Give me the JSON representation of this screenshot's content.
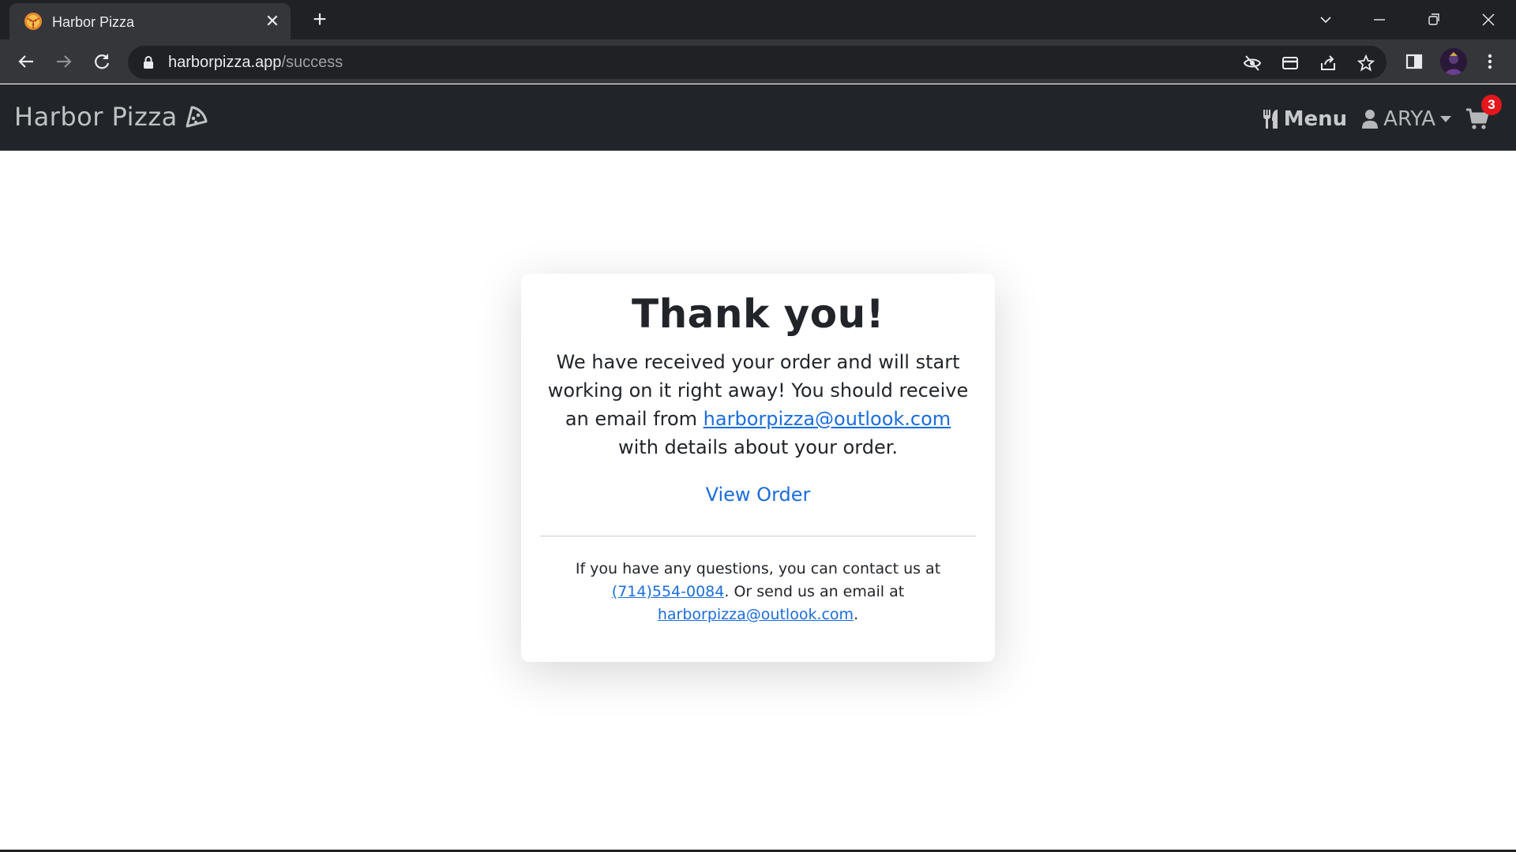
{
  "browser": {
    "tab_title": "Harbor Pizza",
    "url_host": "harborpizza.app",
    "url_path": "/success"
  },
  "navbar": {
    "brand": "Harbor Pizza",
    "menu_label": "Menu",
    "user_label": "ARYA",
    "cart_count": "3"
  },
  "card": {
    "title": "Thank you!",
    "body_prefix": "We have received your order and will start working on it right away! You should receive an email from ",
    "body_email": "harborpizza@outlook.com",
    "body_suffix": " with details about your order.",
    "view_order": "View Order",
    "contact_prefix": "If you have any questions, you can contact us at ",
    "contact_phone": "(714)554-0084",
    "contact_middle": ". Or send us an email at ",
    "contact_email": "harborpizza@outlook.com",
    "contact_suffix": "."
  },
  "colors": {
    "navbar_bg": "#212529",
    "link": "#1a6ddc",
    "badge": "#e5161c"
  }
}
